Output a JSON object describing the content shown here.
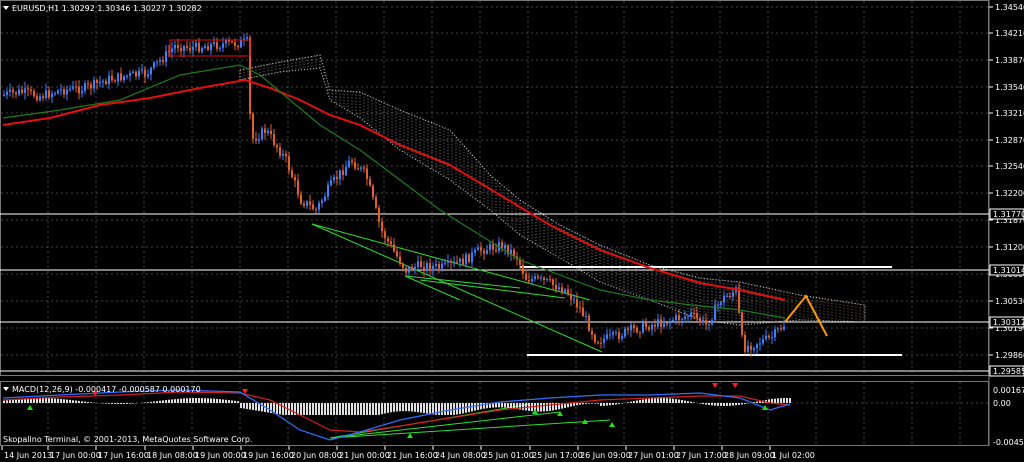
{
  "main_panel": {
    "symbol_header": "EURUSD,H1  1.30292 1.30346 1.30227 1.30282",
    "price_scale": [
      "1.34540",
      "1.34210",
      "1.33870",
      "1.33540",
      "1.33210",
      "1.32870",
      "1.32540",
      "1.32200",
      "1.31870",
      "1.31200",
      "1.30860",
      "1.30530",
      "1.30190",
      "1.29860"
    ],
    "price_tags": {
      "upper_line": "1.31770",
      "middle_line": "1.31014",
      "current": "1.30312",
      "bottom_line": "1.29585"
    }
  },
  "macd_panel": {
    "header": "MACD(12,26,9) -0.000417 -0.000587 0.000170",
    "scale": [
      "0.001672",
      "0.00",
      "-0.004542"
    ]
  },
  "time_axis": [
    "14 Jun 2013",
    "17 Jun 00:00",
    "17 Jun 16:00",
    "18 Jun 08:00",
    "19 Jun 00:00",
    "19 Jun 16:00",
    "20 Jun 08:00",
    "21 Jun 00:00",
    "21 Jun 16:00",
    "24 Jun 08:00",
    "25 Jun 01:00",
    "25 Jun 17:00",
    "26 Jun 09:00",
    "27 Jun 01:00",
    "27 Jun 17:00",
    "28 Jun 09:00",
    "1 Jul 02:00"
  ],
  "copyright": "Skopalino Terminal, © 2001-2013, MetaQuotes Software Corp.",
  "colors": {
    "background": "#000000",
    "grid": "#5a5a5a",
    "ma_red": "#e01010",
    "ma_green": "#1e7a1e",
    "bull_candle": "#3a80ff",
    "bear_candle": "#e0602a",
    "trendline": "#33dd33",
    "projection": "#ff9900",
    "ichimoku_cloud": "#d8d8d8",
    "level_line": "#ffffff"
  },
  "icons": {
    "dropdown": "triangle-down-icon",
    "buy_signal": "green-arrow-up-icon",
    "sell_signal": "red-arrow-down-icon"
  }
}
